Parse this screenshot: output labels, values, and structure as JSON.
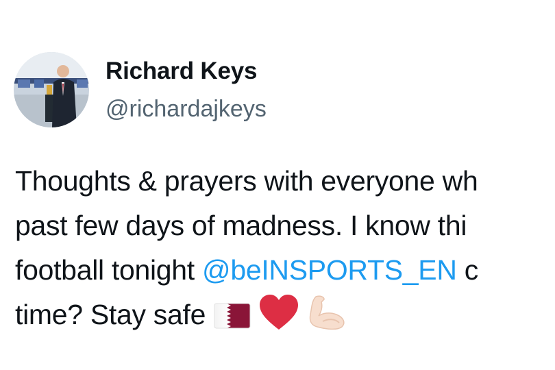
{
  "author": {
    "display_name": "Richard Keys",
    "handle": "@richardajkeys"
  },
  "tweet": {
    "line1": "Thoughts & prayers with everyone wh",
    "line2": "past few days of madness. I know thi",
    "line3_before": "football tonight ",
    "line3_mention": "@beINSPORTS_EN",
    "line3_after": " c",
    "line4": "time? Stay safe ",
    "emojis": [
      "qatar-flag",
      "red-heart",
      "flexed-biceps"
    ]
  },
  "colors": {
    "text": "#0f1419",
    "secondary": "#536471",
    "link": "#1d9bf0",
    "qatar_maroon": "#8a1538",
    "heart_red": "#dd2e44",
    "biceps_skin": "#f7dece"
  }
}
